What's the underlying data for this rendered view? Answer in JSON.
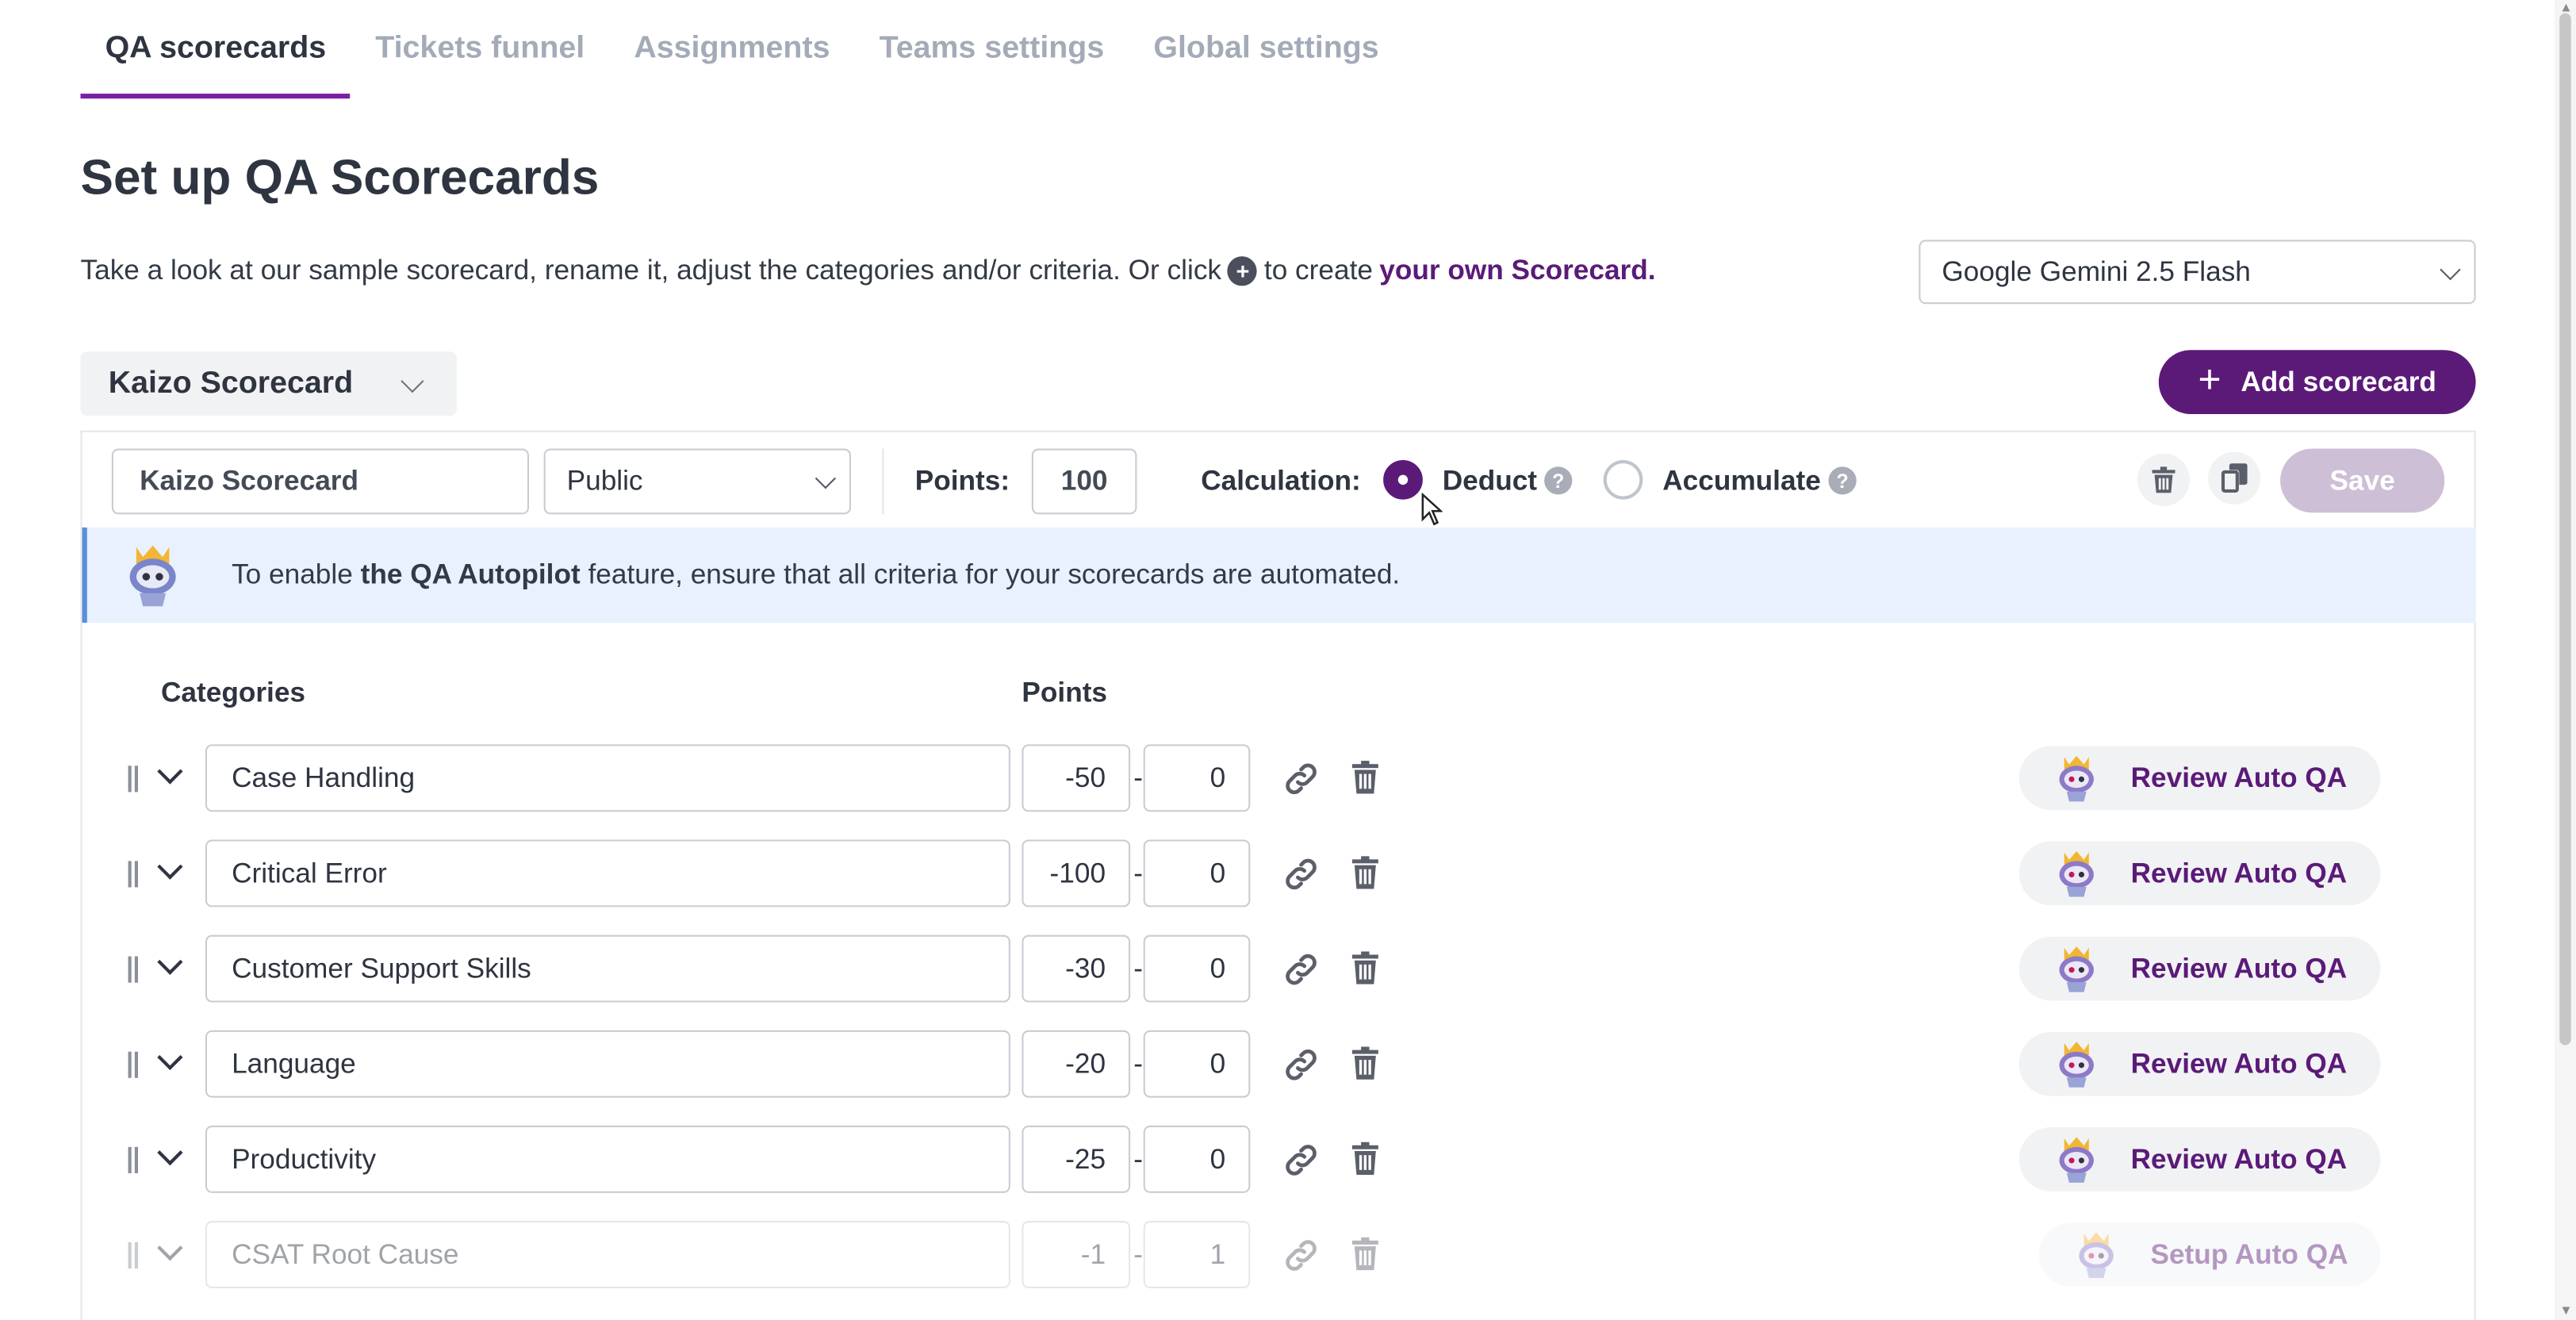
{
  "tabs": [
    {
      "label": "QA scorecards",
      "active": true
    },
    {
      "label": "Tickets funnel",
      "active": false
    },
    {
      "label": "Assignments",
      "active": false
    },
    {
      "label": "Teams settings",
      "active": false
    },
    {
      "label": "Global settings",
      "active": false
    }
  ],
  "page": {
    "title": "Set up QA Scorecards",
    "intro_before": "Take a look at our sample scorecard, rename it, adjust the categories and/or criteria. Or click",
    "intro_plus": "+",
    "intro_after": "to create",
    "intro_link": "your own Scorecard."
  },
  "model_select": {
    "value": "Google Gemini 2.5 Flash"
  },
  "scorecard_picker": {
    "value": "Kaizo Scorecard"
  },
  "add_scorecard": {
    "plus": "+",
    "label": "Add scorecard"
  },
  "editor": {
    "name_value": "Kaizo Scorecard",
    "visibility_value": "Public",
    "points_label": "Points:",
    "points_value": "100",
    "calculation_label": "Calculation:",
    "deduct_label": "Deduct",
    "accumulate_label": "Accumulate",
    "help_glyph": "?",
    "selected_calculation": "Deduct",
    "save_label": "Save"
  },
  "banner": {
    "before": "To enable",
    "bold": "the QA Autopilot",
    "after": "feature, ensure that all criteria for your scorecards are automated."
  },
  "columns": {
    "categories": "Categories",
    "points": "Points"
  },
  "categories": [
    {
      "name": "Case Handling",
      "min": "-50",
      "max": "0",
      "action": "Review Auto QA",
      "dim": false
    },
    {
      "name": "Critical Error",
      "min": "-100",
      "max": "0",
      "action": "Review Auto QA",
      "dim": false
    },
    {
      "name": "Customer Support Skills",
      "min": "-30",
      "max": "0",
      "action": "Review Auto QA",
      "dim": false
    },
    {
      "name": "Language",
      "min": "-20",
      "max": "0",
      "action": "Review Auto QA",
      "dim": false
    },
    {
      "name": "Productivity",
      "min": "-25",
      "max": "0",
      "action": "Review Auto QA",
      "dim": false
    },
    {
      "name": "CSAT Root Cause",
      "min": "-1",
      "max": "1",
      "action": "Setup Auto QA",
      "dim": true
    }
  ],
  "range_separator": "-",
  "colors": {
    "brand": "#5b1a78",
    "tab_underline": "#7b1fa2",
    "banner_bg": "#e8f1fd"
  }
}
